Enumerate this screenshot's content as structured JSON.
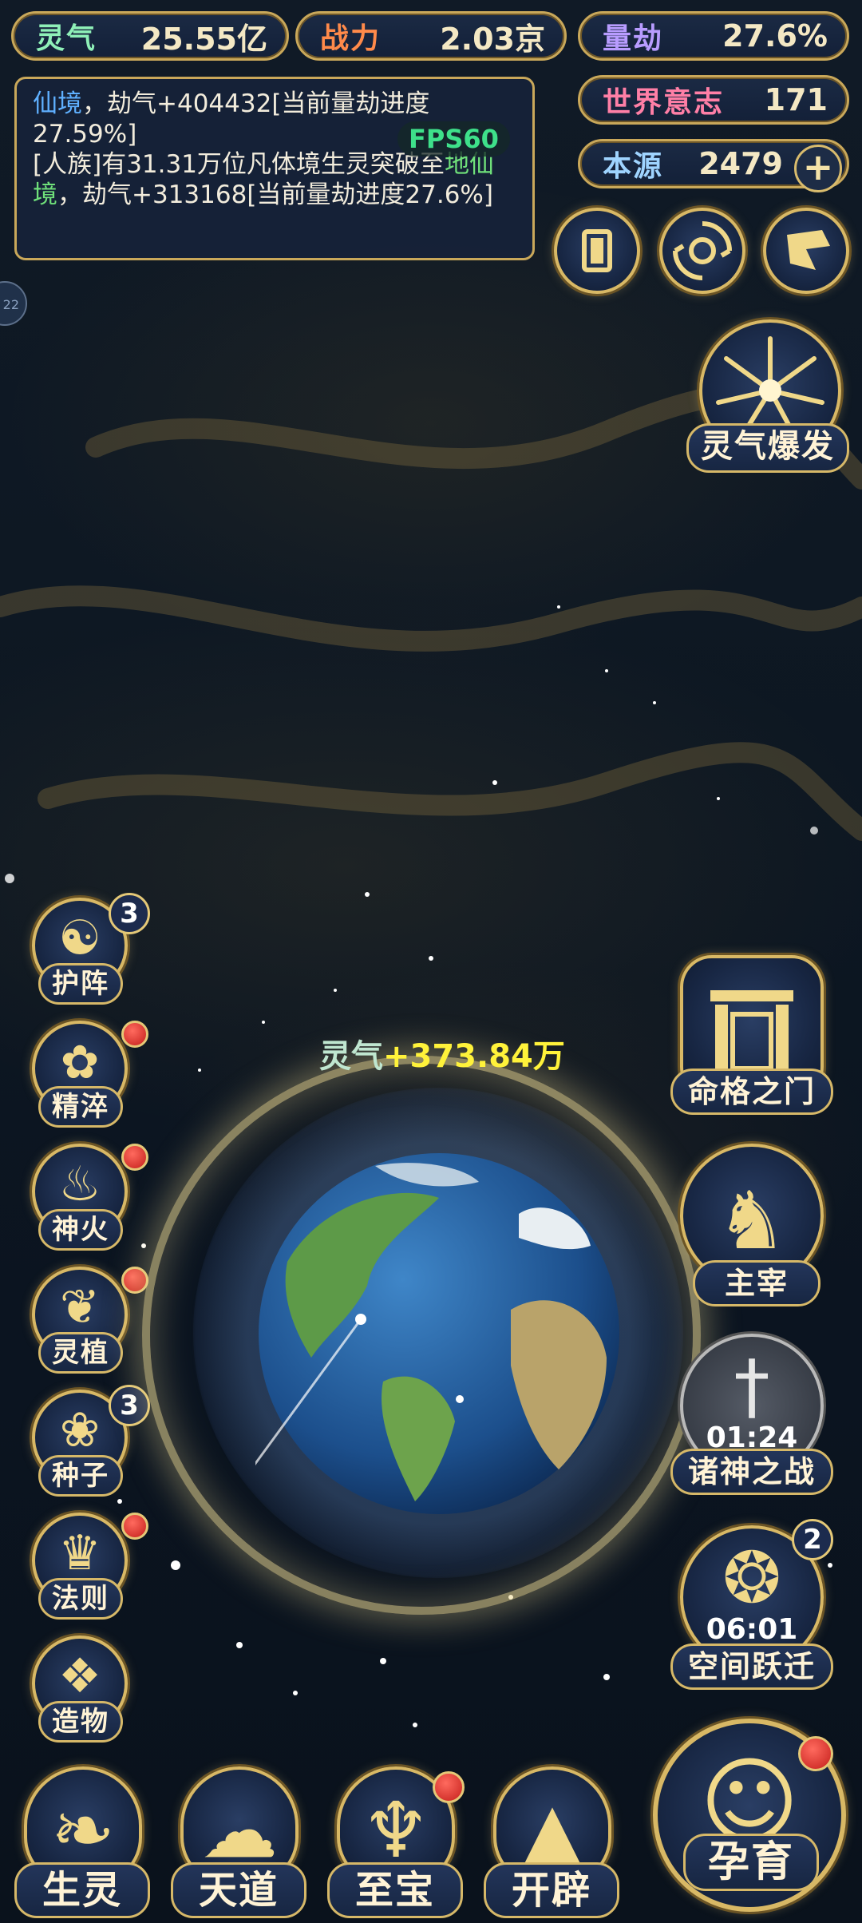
{
  "resources": {
    "lingqi": {
      "label": "灵气",
      "value": "25.55亿"
    },
    "zhanli": {
      "label": "战力",
      "value": "2.03京"
    },
    "liangjie": {
      "label": "量劫",
      "value": "27.6%"
    },
    "shijie": {
      "label": "世界意志",
      "value": "171"
    },
    "benyuan": {
      "label": "本源",
      "value": "2479"
    }
  },
  "log": {
    "line1_realm": "仙境",
    "line1_text": "，劫气+404432[当前量劫进度27.59%]",
    "line2_text": "[人族]有31.31万位凡体境生灵突破至",
    "line2_realm": "地仙境",
    "line2_tail": "，劫气+313168[当前量劫进度27.6%]"
  },
  "fps": "FPS60",
  "side_tab": "22",
  "burst": {
    "label": "灵气爆发"
  },
  "gain": {
    "label": "灵气",
    "value": "+373.84万"
  },
  "left_menu": [
    {
      "label": "护阵",
      "badge": "3"
    },
    {
      "label": "精淬",
      "badge": ""
    },
    {
      "label": "神火",
      "badge": ""
    },
    {
      "label": "灵植",
      "badge": ""
    },
    {
      "label": "种子",
      "badge": "3"
    },
    {
      "label": "法则",
      "badge": ""
    },
    {
      "label": "造物",
      "badge": ""
    }
  ],
  "right_menu": {
    "mingge": {
      "label": "命格之门"
    },
    "zhuzai": {
      "label": "主宰"
    },
    "zhushen": {
      "label": "诸神之战",
      "timer": "01:24"
    },
    "kongjian": {
      "label": "空间跃迁",
      "timer": "06:01",
      "badge": "2"
    }
  },
  "bottom": [
    {
      "label": "生灵"
    },
    {
      "label": "天道"
    },
    {
      "label": "至宝"
    },
    {
      "label": "开辟"
    }
  ],
  "yunyu": {
    "label": "孕育"
  },
  "colors": {
    "gold": "#d8b865",
    "panel": "#16223a",
    "green": "#6fe07a",
    "blue": "#5fb0ff",
    "yellow": "#fff23a"
  }
}
